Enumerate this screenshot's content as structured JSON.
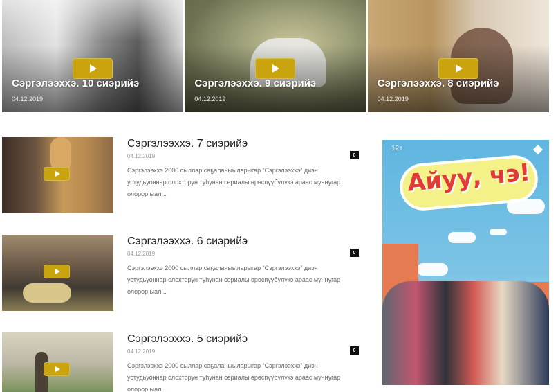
{
  "featured": [
    {
      "title": "Сэргэлээхxэ. 10 сиэрийэ",
      "date": "04.12.2019"
    },
    {
      "title": "Сэргэлээхxэ. 9 сиэрийэ",
      "date": "04.12.2019"
    },
    {
      "title": "Сэргэлээхxэ. 8 сиэрийэ",
      "date": "04.12.2019"
    }
  ],
  "list": [
    {
      "title": "Сэргэлээхxэ. 7 сиэрийэ",
      "date": "04.12.2019",
      "count": "0",
      "desc": "Сэргэлээхxэ 2000 сыллар саҕаланыыларыгар “Сэргэлээхxэ” диэн устудьуоннар олохторун туһунан сериалы өрөспүүбүлүкэ араас муннугар олорор ыал..."
    },
    {
      "title": "Сэргэлээхxэ. 6 сиэрийэ",
      "date": "04.12.2019",
      "count": "0",
      "desc": "Сэргэлээхxэ 2000 сыллар саҕаланыыларыгар “Сэргэлээхxэ” диэн устудьуоннар олохторун туһунан сериалы өрөспүүбүлүкэ араас муннугар олорор ыал..."
    },
    {
      "title": "Сэргэлээхxэ. 5 сиэрийэ",
      "date": "04.12.2019",
      "count": "0",
      "desc": "Сэргэлээхxэ 2000 сыллар саҕаланыыларыгар “Сэргэлээхxэ” диэн устудьуоннар олохторун туһунан сериалы өрөспүүбүлүкэ араас муннугар олорор ыал..."
    }
  ],
  "poster": {
    "age_rating": "12+",
    "logo_text": "Айуу, чэ!",
    "colors": {
      "sky": "#5fb6e0",
      "logo": "#e23a34",
      "cloud": "#f4f188",
      "accent": "#c9a40e"
    }
  },
  "icons": {
    "play": "play-icon",
    "corner": "diamond-icon"
  }
}
